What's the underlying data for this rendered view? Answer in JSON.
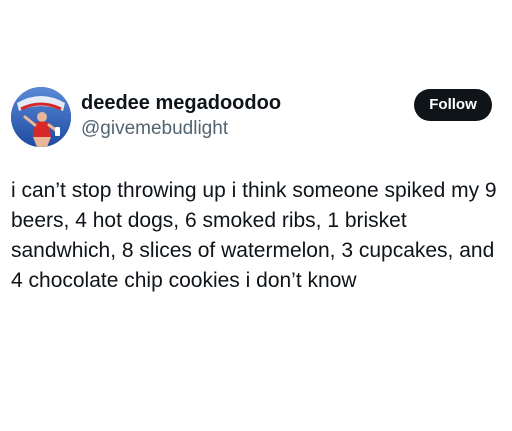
{
  "author": {
    "display_name": "deedee megadoodoo",
    "handle": "@givemebudlight",
    "avatar_icon": "bud-light-avatar-icon",
    "avatar_colors": {
      "background": "#2b57b3",
      "accent": "#d62828"
    }
  },
  "actions": {
    "follow_label": "Follow"
  },
  "tweet": {
    "text": "i can’t stop throwing up i think someone spiked my 9 beers, 4 hot dogs, 6 smoked ribs, 1 brisket sandwhich, 8 slices of watermelon, 3 cupcakes, and 4 chocolate chip cookies i don’t know"
  }
}
